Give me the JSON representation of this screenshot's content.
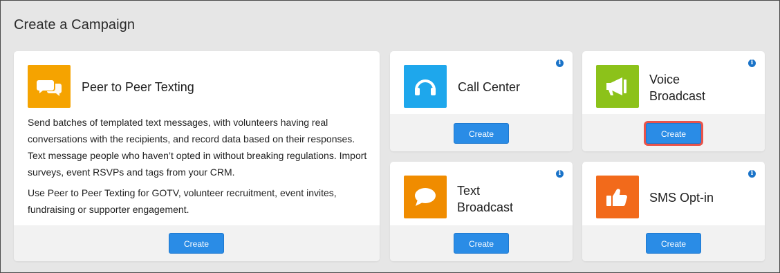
{
  "page": {
    "title": "Create a Campaign"
  },
  "cards": {
    "peer": {
      "title": "Peer to Peer Texting",
      "description_1": "Send batches of templated text messages, with volunteers having real conversations with the recipients, and record data based on their responses. Text message people who haven’t opted in without breaking regulations. Import surveys, event RSVPs and tags from your CRM.",
      "description_2": "Use Peer to Peer Texting for GOTV, volunteer recruitment, event invites, fundraising or supporter engagement.",
      "button": "Create",
      "icon": "chat-bubbles-icon",
      "color": "#f5a300"
    },
    "call_center": {
      "title": "Call Center",
      "button": "Create",
      "icon": "headphones-icon",
      "color": "#1ea7ec"
    },
    "voice": {
      "title_line1": "Voice",
      "title_line2": "Broadcast",
      "button": "Create",
      "icon": "megaphone-icon",
      "color": "#8cc21a"
    },
    "text": {
      "title_line1": "Text",
      "title_line2": "Broadcast",
      "button": "Create",
      "icon": "speech-bubble-icon",
      "color": "#f08c00"
    },
    "sms": {
      "title": "SMS Opt-in",
      "button": "Create",
      "icon": "thumbs-up-icon",
      "color": "#f26a1b"
    }
  },
  "info_glyph": "i",
  "colors": {
    "button": "#2a8ce6",
    "highlight": "#e8544b"
  }
}
